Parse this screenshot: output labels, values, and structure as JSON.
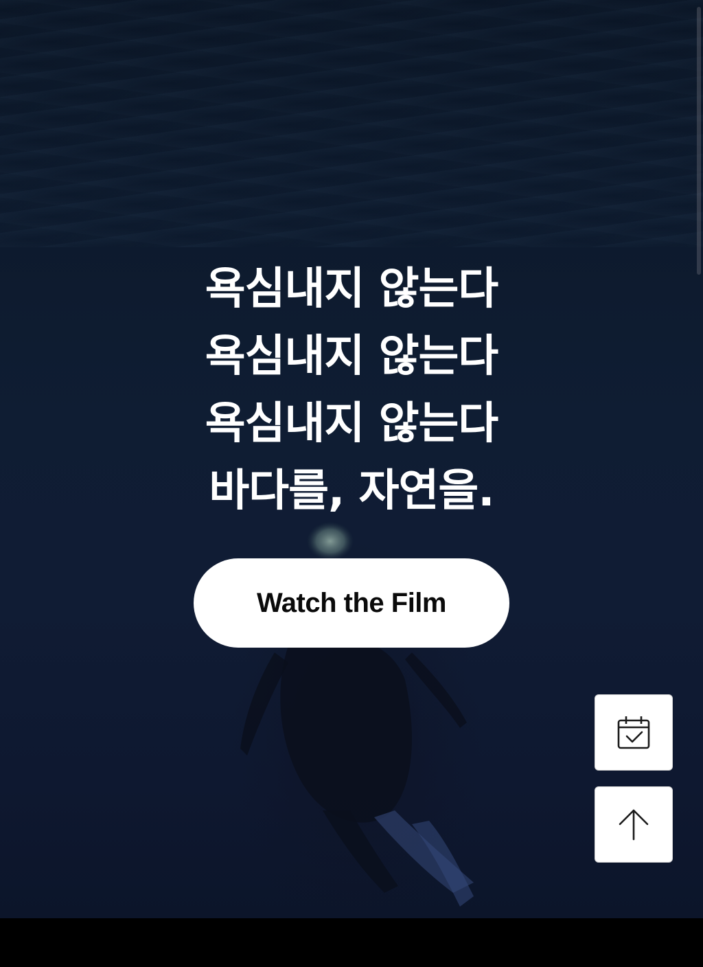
{
  "hero": {
    "headline_lines": [
      "욕심내지 않는다",
      "욕심내지 않는다",
      "욕심내지 않는다",
      "바다를, 자연을."
    ],
    "cta_label": "Watch the Film"
  },
  "floating_actions": {
    "calendar_icon": "calendar-check-icon",
    "scroll_top_icon": "arrow-up-icon"
  },
  "colors": {
    "background": "#0f1d33",
    "text": "#ffffff",
    "button_bg": "#ffffff",
    "button_text": "#0a0a0a"
  }
}
